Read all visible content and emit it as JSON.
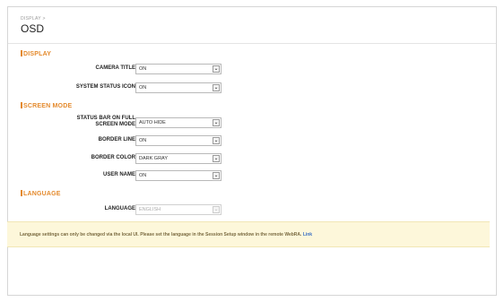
{
  "header": {
    "breadcrumb": "DISPLAY >",
    "title": "OSD"
  },
  "sections": {
    "display": "DISPLAY",
    "screen_mode": "SCREEN MODE",
    "language": "LANGUAGE"
  },
  "fields": {
    "camera_title": {
      "label": "CAMERA TITLE",
      "value": "ON"
    },
    "system_status_icon": {
      "label": "SYSTEM STATUS ICON",
      "value": "ON"
    },
    "status_bar": {
      "label": "STATUS BAR ON FULL SCREEN MODE",
      "value": "AUTO HIDE"
    },
    "border_line": {
      "label": "BORDER LINE",
      "value": "ON"
    },
    "border_color": {
      "label": "BORDER COLOR",
      "value": "DARK GRAY"
    },
    "user_name": {
      "label": "USER NAME",
      "value": "ON"
    },
    "language": {
      "label": "LANGUAGE",
      "value": "ENGLISH"
    }
  },
  "notice": {
    "text": "Language settings can only be changed via the local UI. Please set the language in the Session Setup window in the remote WebRA.",
    "link": "Link"
  },
  "icons": {
    "dropdown": "chevron-down-icon"
  },
  "colors": {
    "section_accent": "#e48a2d",
    "notice_bg": "#fdf7da",
    "link": "#3a6fc4"
  }
}
